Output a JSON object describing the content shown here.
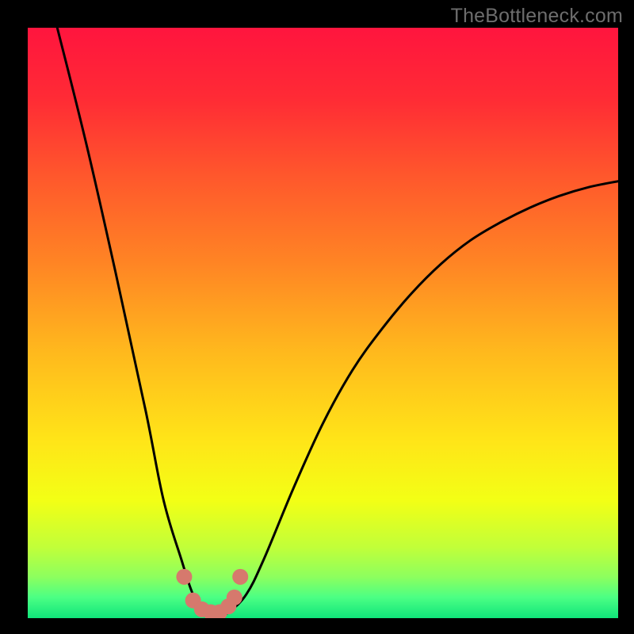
{
  "watermark": "TheBottleneck.com",
  "gradient": {
    "stops": [
      {
        "offset": 0.0,
        "color": "#ff153e"
      },
      {
        "offset": 0.12,
        "color": "#ff2b35"
      },
      {
        "offset": 0.25,
        "color": "#ff572c"
      },
      {
        "offset": 0.4,
        "color": "#ff8524"
      },
      {
        "offset": 0.55,
        "color": "#ffb91d"
      },
      {
        "offset": 0.7,
        "color": "#ffe518"
      },
      {
        "offset": 0.8,
        "color": "#f3ff15"
      },
      {
        "offset": 0.88,
        "color": "#c1ff39"
      },
      {
        "offset": 0.93,
        "color": "#8dff5e"
      },
      {
        "offset": 0.965,
        "color": "#4bff84"
      },
      {
        "offset": 1.0,
        "color": "#10e57a"
      }
    ]
  },
  "chart_data": {
    "type": "line",
    "title": "",
    "xlabel": "",
    "ylabel": "",
    "xlim": [
      0,
      100
    ],
    "ylim": [
      0,
      100
    ],
    "grid": false,
    "legend": false,
    "series": [
      {
        "name": "bottleneck-curve",
        "x": [
          5,
          10,
          15,
          20,
          23,
          26,
          28,
          30,
          32,
          34,
          37,
          40,
          45,
          50,
          55,
          60,
          65,
          70,
          75,
          80,
          85,
          90,
          95,
          100
        ],
        "y": [
          100,
          80,
          58,
          35,
          20,
          10,
          4,
          1,
          0,
          1,
          4,
          10,
          22,
          33,
          42,
          49,
          55,
          60,
          64,
          67,
          69.5,
          71.5,
          73,
          74
        ]
      }
    ],
    "markers": {
      "name": "curve-trough-markers",
      "x": [
        26.5,
        28,
        29.5,
        31,
        32.5,
        34,
        35,
        36
      ],
      "y": [
        7,
        3,
        1.5,
        1,
        1,
        2,
        3.5,
        7
      ],
      "color": "#d6796d",
      "size": 10
    }
  }
}
